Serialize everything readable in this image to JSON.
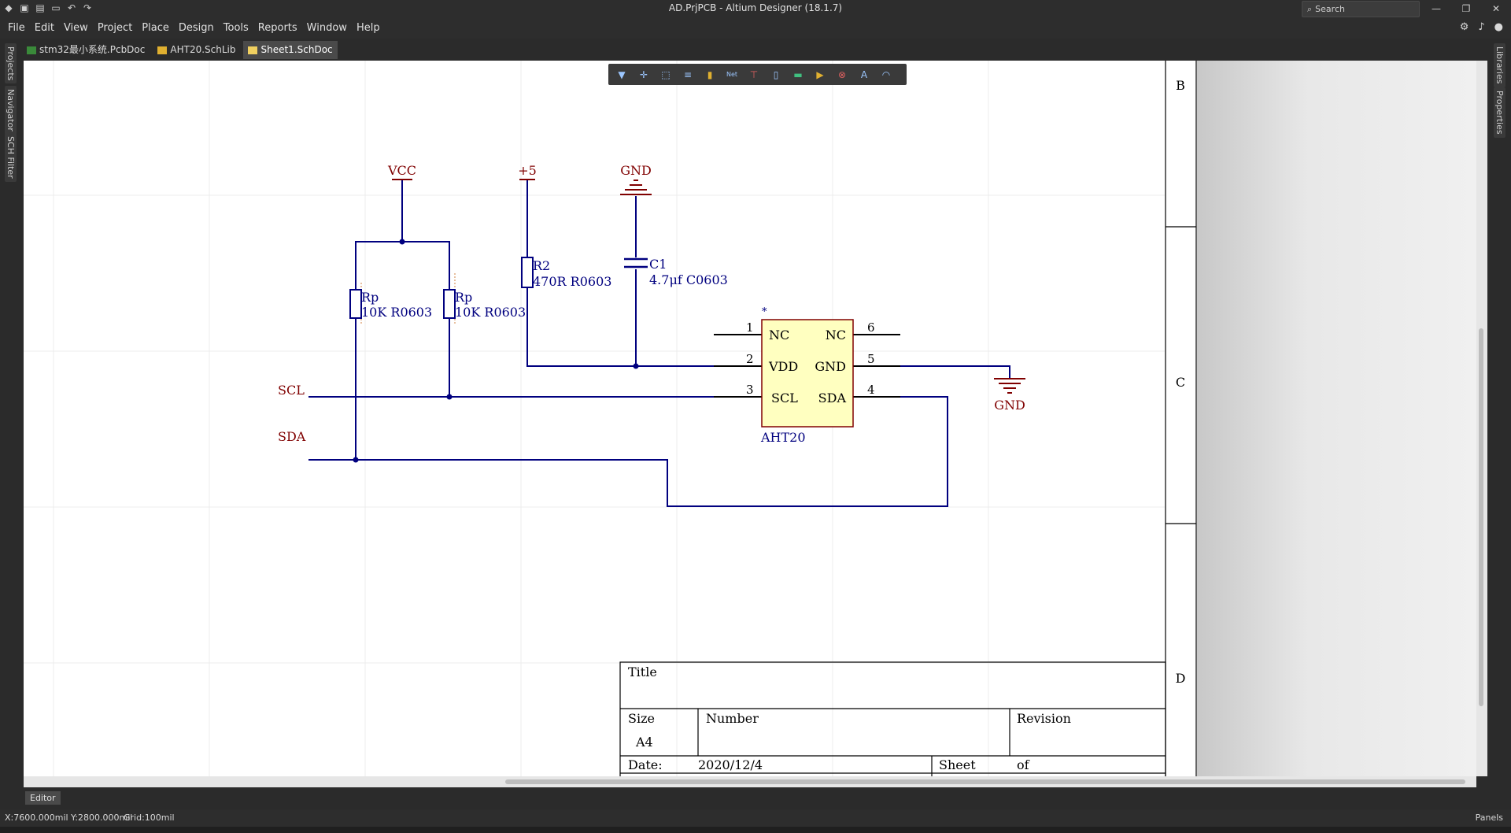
{
  "window": {
    "title": "AD.PrjPCB - Altium Designer (18.1.7)"
  },
  "search": {
    "placeholder": "Search"
  },
  "menu": [
    "File",
    "Edit",
    "View",
    "Project",
    "Place",
    "Design",
    "Tools",
    "Reports",
    "Window",
    "Help"
  ],
  "tabs": [
    {
      "label": "stm32最小系统.PcbDoc",
      "active": false
    },
    {
      "label": "AHT20.SchLib",
      "active": false
    },
    {
      "label": "Sheet1.SchDoc",
      "active": true
    }
  ],
  "left_panels": [
    "Projects",
    "Navigator",
    "SCH Filter"
  ],
  "right_panels": [
    "Libraries",
    "Properties"
  ],
  "schematic": {
    "zone_labels": [
      "B",
      "C",
      "D"
    ],
    "nets": {
      "vcc": "VCC",
      "p5": "+5",
      "gnd_top": "GND",
      "gnd_right": "GND",
      "scl": "SCL",
      "sda": "SDA"
    },
    "rp1": {
      "designator": "Rp",
      "value": "10K R0603"
    },
    "rp2": {
      "designator": "Rp",
      "value": "10K R0603"
    },
    "r2": {
      "designator": "R2",
      "value": "470R R0603"
    },
    "c1": {
      "designator": "C1",
      "value": "4.7μf C0603"
    },
    "ic": {
      "name": "AHT20",
      "marker": "*",
      "pins": {
        "p1": "1",
        "p2": "2",
        "p3": "3",
        "p4": "4",
        "p5": "5",
        "p6": "6"
      },
      "left": [
        "NC",
        "VDD",
        "SCL"
      ],
      "right": [
        "NC",
        "GND",
        "SDA"
      ]
    },
    "titleblock": {
      "title_label": "Title",
      "size_label": "Size",
      "size_value": "A4",
      "number_label": "Number",
      "revision_label": "Revision",
      "date_label": "Date:",
      "date_value": "2020/12/4",
      "sheet_label": "Sheet",
      "of_label": "of"
    }
  },
  "editor_tab": "Editor",
  "status": {
    "coords": "X:7600.000mil Y:2800.000mil",
    "grid": "Grid:100mil",
    "panels": "Panels"
  },
  "colors": {
    "wire": "#00007f",
    "netlabel": "#800000",
    "part_fill": "#ffffc0",
    "part_border": "#800000"
  }
}
